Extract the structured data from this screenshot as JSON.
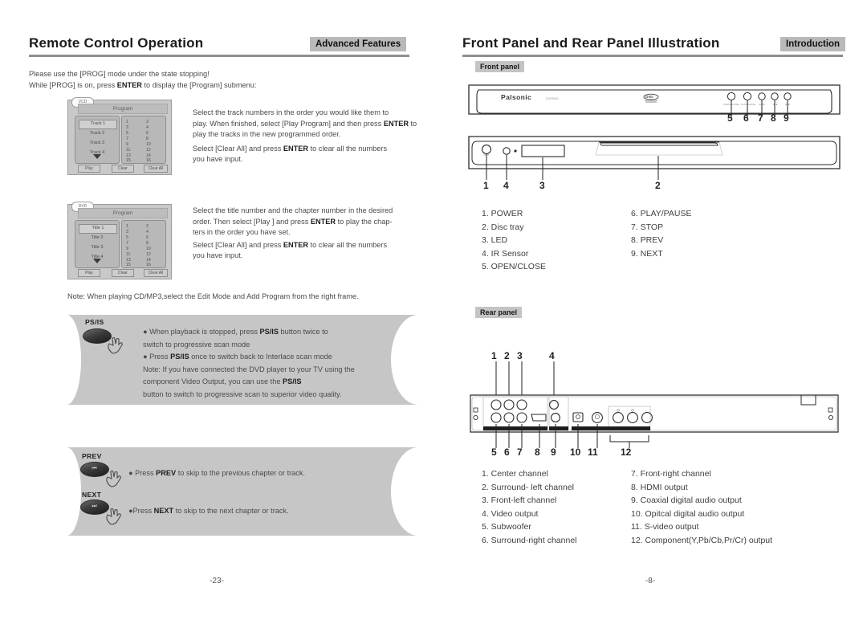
{
  "left_page": {
    "header": {
      "title": "Remote Control Operation",
      "tag": "Advanced Features"
    },
    "intro": {
      "line1": "Please use the [PROG] mode under the state stopping!",
      "line2_a": "While [PROG] is on, press ",
      "line2_b": "ENTER",
      "line2_c": " to display the [Program] submenu:"
    },
    "program_vcd": {
      "badge": "VCD",
      "title": "Program",
      "items": [
        "Track 1",
        "Track 2",
        "Track 3",
        "Track 4"
      ],
      "numbers": [
        "1",
        "2",
        "3",
        "4",
        "5",
        "6",
        "7",
        "8",
        "9",
        "10",
        "11",
        "12",
        "13",
        "14",
        "15",
        "16"
      ],
      "buttons": [
        "Play",
        "Clear",
        "Clear All"
      ],
      "description": [
        "Select the track numbers in the order you would like them to",
        "play. When finished, select [Play Program] and then press ENTER to",
        "play the tracks in the new programmed order.",
        "Select [Clear All] and press ENTER to clear all the numbers",
        " you have input."
      ]
    },
    "program_dvd": {
      "badge": "DVD",
      "title": "Program",
      "items": [
        "Title 1",
        "Title 2",
        "Title 3",
        "Title 4"
      ],
      "numbers": [
        "1",
        "2",
        "3",
        "4",
        "5",
        "6",
        "7",
        "8",
        "9",
        "10",
        "11",
        "12",
        "13",
        "14",
        "15",
        "16"
      ],
      "buttons": [
        "Play",
        "Clear",
        "Clear All"
      ],
      "description": [
        "Select the title number and the chapter number in the desired",
        "order. Then select [Play ] and press ENTER to play the chap-",
        "ters in the order you have set.",
        "Select [Clear All] and press ENTER to clear all the numbers",
        "you have input."
      ]
    },
    "note": "Note: When playing CD/MP3,select the Edit Mode and Add Program from the right frame.",
    "psis_block": {
      "button_label": "PS/IS",
      "lines": [
        "● When playback is stopped, press PS/IS button twice to",
        "switch to progressive scan mode",
        "● Press PS/IS once to switch back to Interlace scan mode",
        "Note: If you have connected the DVD player to your TV using the",
        "component Video Output, you can use the PS/IS",
        "button to switch to progressive scan to superior video quality."
      ]
    },
    "prev_block": {
      "button_label": "PREV",
      "glyph": "⏮",
      "text": "● Press PREV to skip to the previous chapter or track."
    },
    "next_block": {
      "button_label": "NEXT",
      "glyph": "⏭",
      "text": "●Press NEXT to skip to the next chapter or track."
    },
    "page_number": "-23-"
  },
  "right_page": {
    "header": {
      "title": "Front Panel and Rear Panel Illustration",
      "tag": "Introduction"
    },
    "front_panel": {
      "tag": "Front panel",
      "brand": "Palsonic",
      "model": "DVD9000",
      "disc_logo": "DVD",
      "top_callouts": [
        "5",
        "6",
        "7",
        "8",
        "9"
      ],
      "bottom_callouts": [
        "1",
        "4",
        "3",
        "2"
      ],
      "legend_left": [
        "1. POWER",
        "2. Disc tray",
        "3. LED",
        "4. IR Sensor",
        "5. OPEN/CLOSE"
      ],
      "legend_right": [
        "6. PLAY/PAUSE",
        "7. STOP",
        "8. PREV",
        "9. NEXT"
      ]
    },
    "rear_panel": {
      "tag": "Rear panel",
      "top_callouts": [
        "1",
        "2",
        "3",
        "4"
      ],
      "bottom_callouts": [
        "5",
        "6",
        "7",
        "8",
        "9",
        "10",
        "11",
        "12"
      ],
      "legend_left": [
        "1. Center channel",
        "2. Surround- left channel",
        "3. Front-left channel",
        "4. Video output",
        "5. Subwoofer",
        "6. Surround-right channel"
      ],
      "legend_right": [
        "7. Front-right channel",
        "8. HDMI output",
        "9. Coaxial digital audio output",
        "10. Opitcal digital audio output",
        "11. S-video output",
        "12. Component(Y,Pb/Cb,Pr/Cr) output"
      ]
    },
    "page_number": "-8-"
  }
}
